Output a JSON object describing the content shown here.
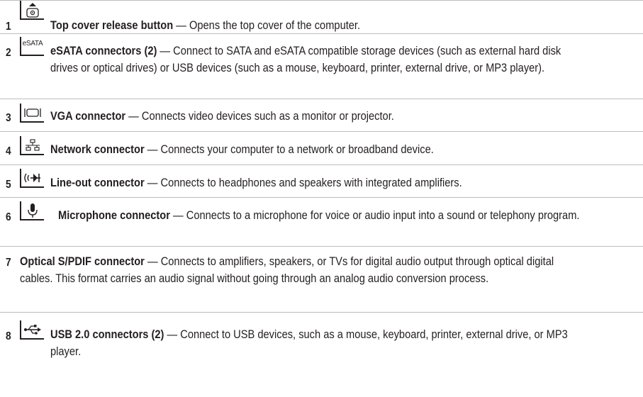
{
  "items": [
    {
      "number": "1",
      "icon": "top-cover-release-icon",
      "term": "Top cover release button",
      "sep": " — ",
      "desc": "Opens the top cover of the computer."
    },
    {
      "number": "2",
      "icon": "esata-icon",
      "icon_text": "eSATA",
      "term": "eSATA connectors (2)",
      "sep": " — ",
      "desc": "Connect to SATA and eSATA compatible storage devices (such as external hard disk drives or optical drives) or USB devices (such as a mouse, keyboard, printer, external drive, or MP3 player)."
    },
    {
      "number": "3",
      "icon": "vga-icon",
      "term": "VGA connector",
      "sep": " — ",
      "desc": "Connects video devices such as a monitor or projector."
    },
    {
      "number": "4",
      "icon": "network-icon",
      "term": "Network connector",
      "sep": " — ",
      "desc": "Connects your computer to a network or broadband device."
    },
    {
      "number": "5",
      "icon": "line-out-icon",
      "term": "Line-out connector",
      "sep": " — ",
      "desc": "Connects to headphones and speakers with integrated amplifiers."
    },
    {
      "number": "6",
      "icon": "microphone-icon",
      "term": "Microphone connector",
      "sep": " — ",
      "desc": "Connects to a microphone for voice or audio input into a sound or telephony program."
    },
    {
      "number": "7",
      "term": "Optical S/PDIF connector",
      "sep": "  — ",
      "desc": "Connects to amplifiers, speakers, or TVs for digital audio output through optical digital cables. This format carries an audio signal without going through an analog audio conversion process."
    },
    {
      "number": "8",
      "icon": "usb-icon",
      "term": "USB 2.0 connectors (2)",
      "sep": " — ",
      "desc": "Connect to USB devices, such as a mouse, keyboard, printer, external drive, or MP3 player."
    }
  ]
}
